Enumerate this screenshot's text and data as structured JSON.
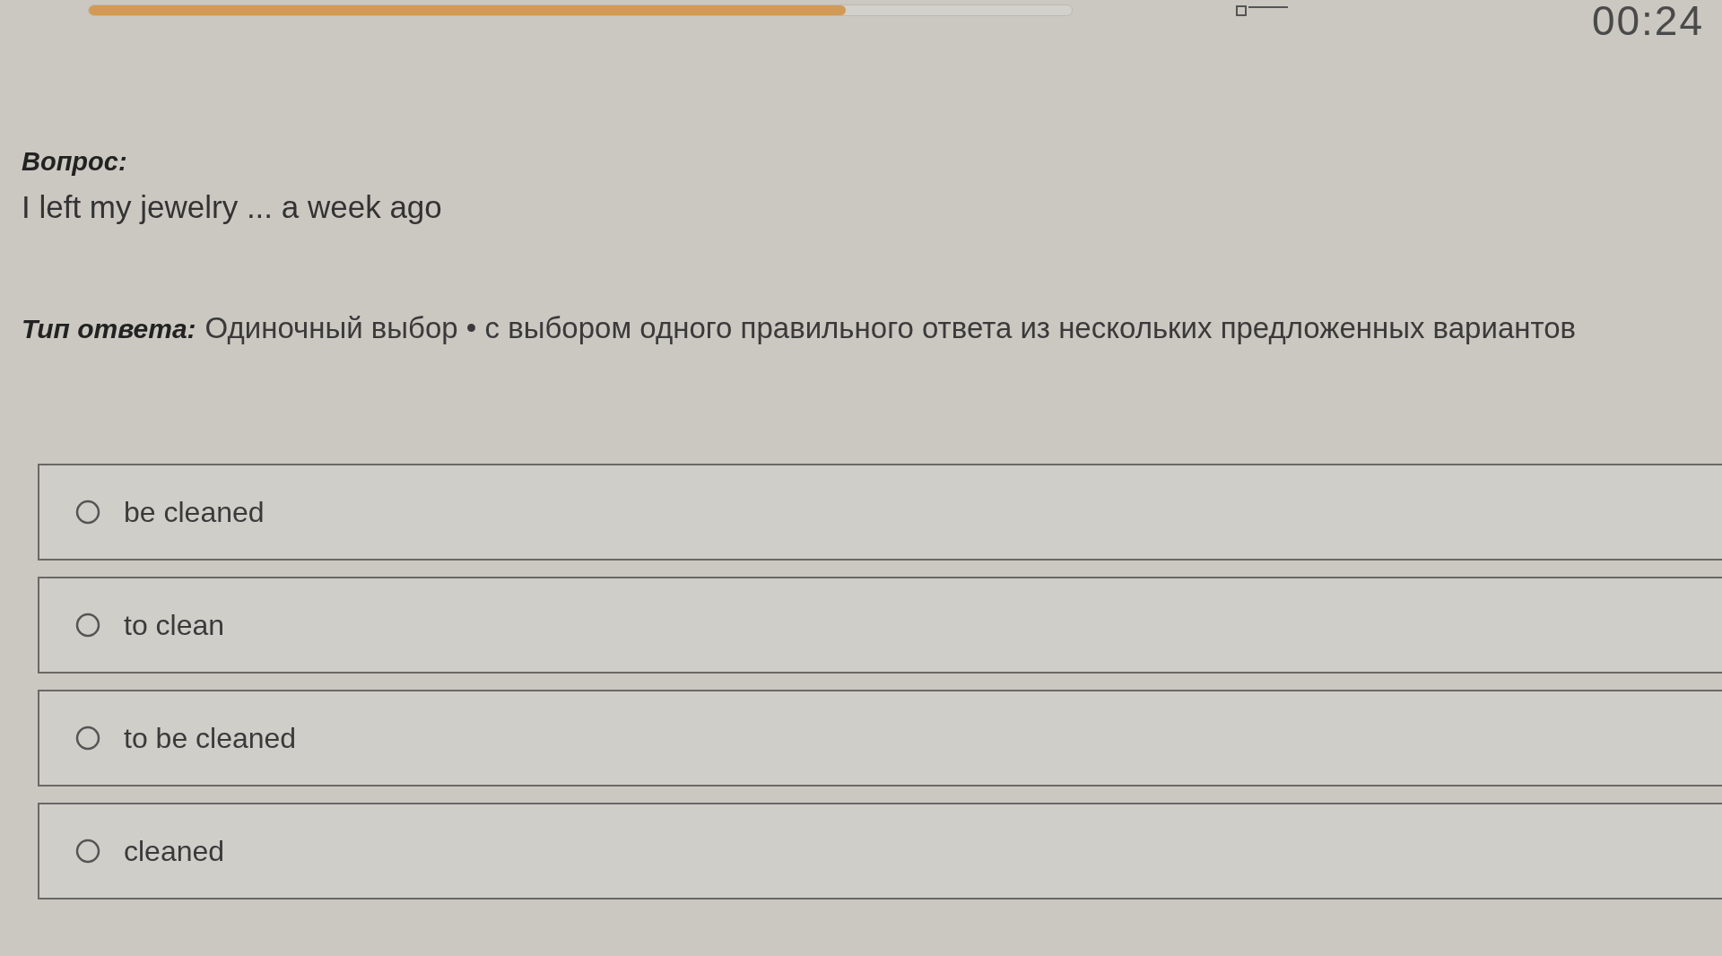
{
  "progress": {
    "level": 0.77
  },
  "timer": "00:24",
  "question": {
    "label": "Вопрос:",
    "text": "I left my jewelry ... a week ago"
  },
  "answer_type": {
    "label": "Тип ответа:",
    "text": "Одиночный выбор • с выбором одного правильного ответа из нескольких предложенных вариантов"
  },
  "options": [
    {
      "text": "be cleaned",
      "selected": false
    },
    {
      "text": "to clean",
      "selected": false
    },
    {
      "text": "to be cleaned",
      "selected": false
    },
    {
      "text": "cleaned",
      "selected": false
    }
  ]
}
